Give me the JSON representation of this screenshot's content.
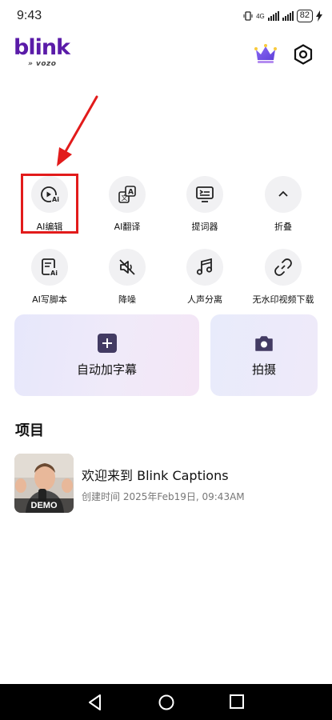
{
  "status_bar": {
    "time": "9:43",
    "network": "4G",
    "battery": "82"
  },
  "header": {
    "logo_text": "blink",
    "logo_sub": "vozo",
    "premium_icon": "crown-icon",
    "settings_icon": "gear-icon"
  },
  "tools": [
    {
      "label": "AI编辑",
      "icon": "ai-edit-icon"
    },
    {
      "label": "AI翻译",
      "icon": "translate-icon"
    },
    {
      "label": "提词器",
      "icon": "teleprompter-icon"
    },
    {
      "label": "折叠",
      "icon": "chevron-up-icon"
    },
    {
      "label": "AI写脚本",
      "icon": "ai-script-icon"
    },
    {
      "label": "降噪",
      "icon": "mute-icon"
    },
    {
      "label": "人声分离",
      "icon": "music-note-icon"
    },
    {
      "label": "无水印视频下载",
      "icon": "link-icon"
    }
  ],
  "cards": {
    "auto_captions": "自动加字幕",
    "shoot": "拍摄"
  },
  "projects": {
    "section_title": "项目",
    "items": [
      {
        "title": "欢迎来到 Blink Captions",
        "meta": "创建时间 2025年Feb19日, 09:43AM",
        "badge": "DEMO"
      }
    ]
  },
  "colors": {
    "brand": "#5a1ba8",
    "highlight": "#e21b1b",
    "card_icon": "#433b63"
  }
}
